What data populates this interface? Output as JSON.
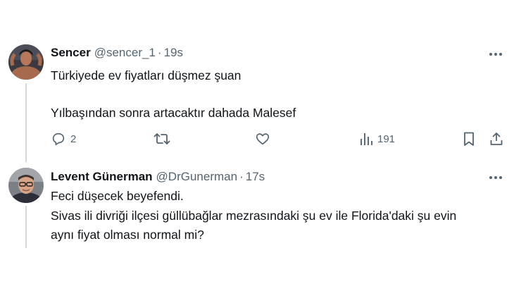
{
  "tweets": [
    {
      "display_name": "Sencer",
      "handle": "@sencer_1",
      "separator": "·",
      "time": "19s",
      "avatar_icon": "user-photo-icon",
      "text_lines": [
        "Türkiyede ev fiyatları düşmez şuan",
        "Yılbaşından sonra artacaktır dahada Malesef"
      ],
      "actions": {
        "reply_count": "2",
        "retweet_count": "",
        "like_count": "",
        "views_count": "191"
      }
    },
    {
      "display_name": "Levent Günerman",
      "handle": "@DrGunerman",
      "separator": "·",
      "time": "17s",
      "avatar_icon": "user-photo-icon",
      "text_lines": [
        "Feci düşecek beyefendi.",
        "Sivas ili divriği ilçesi güllübağlar mezrasındaki şu ev ile Florida'daki şu evin",
        "aynı fiyat olması normal mi?"
      ]
    }
  ],
  "colors": {
    "text": "#0f1419",
    "secondary": "#536471",
    "thread_line": "#cfd9de"
  },
  "icons": [
    "more-icon",
    "reply-icon",
    "retweet-icon",
    "like-icon",
    "views-icon",
    "bookmark-icon",
    "share-icon"
  ]
}
